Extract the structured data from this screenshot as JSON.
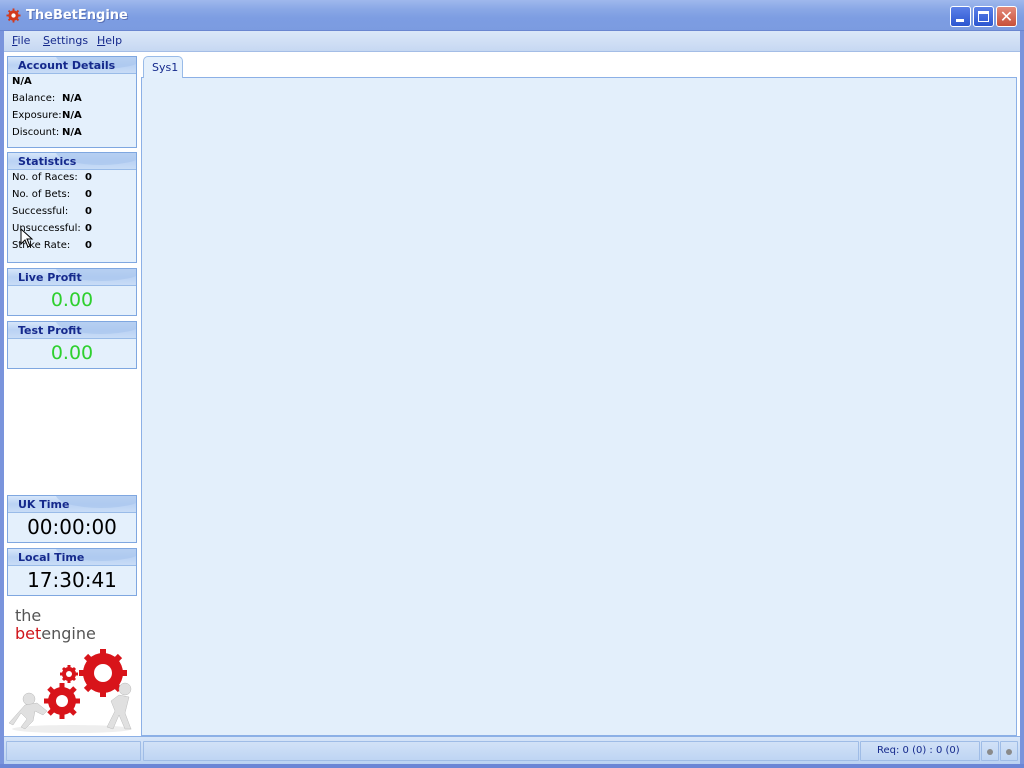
{
  "window": {
    "title": "TheBetEngine",
    "controls": {
      "minimize": "minimize",
      "maximize": "maximize",
      "close": "✕"
    }
  },
  "menubar": {
    "items": [
      {
        "label_u": "F",
        "label_rest": "ile"
      },
      {
        "label_u": "S",
        "label_rest": "ettings"
      },
      {
        "label_u": "H",
        "label_rest": "elp"
      }
    ]
  },
  "sidebar": {
    "account": {
      "title": "Account Details",
      "name": "N/A",
      "rows": [
        {
          "label": "Balance:",
          "value": "N/A"
        },
        {
          "label": "Exposure:",
          "value": "N/A"
        },
        {
          "label": "Discount:",
          "value": "N/A"
        }
      ]
    },
    "statistics": {
      "title": "Statistics",
      "rows": [
        {
          "label": "No. of Races:",
          "value": "0"
        },
        {
          "label": "No. of Bets:",
          "value": "0"
        },
        {
          "label": "Successful:",
          "value": "0"
        },
        {
          "label": "Unsuccessful:",
          "value": "0"
        },
        {
          "label": "Strike Rate:",
          "value": "0"
        }
      ]
    },
    "live_profit": {
      "title": "Live Profit",
      "value": "0.00"
    },
    "test_profit": {
      "title": "Test Profit",
      "value": "0.00"
    },
    "uk_time": {
      "title": "UK Time",
      "value": "00:00:00"
    },
    "local_time": {
      "title": "Local Time",
      "value": "17:30:41"
    },
    "logo": {
      "line1": "the",
      "line2_red": "bet",
      "line2_rest": "engine"
    }
  },
  "tabs": [
    {
      "label": "Sys1",
      "active": true
    }
  ],
  "statusbar": {
    "left": "",
    "middle": "",
    "requests": "Req: 0 (0) : 0 (0)"
  },
  "colors": {
    "accent_text": "#15298c",
    "profit_green": "#2ed02e",
    "logo_red": "#d0141a"
  }
}
